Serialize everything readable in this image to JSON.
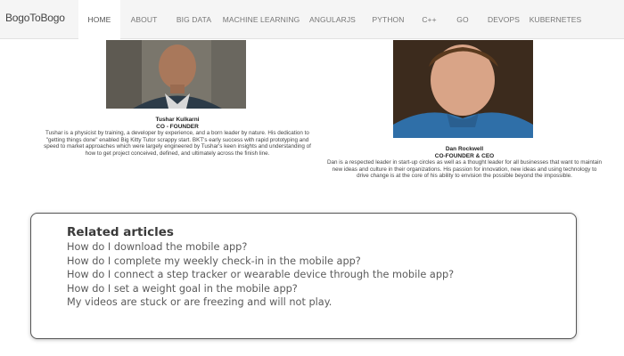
{
  "brand": "BogoToBogo",
  "nav": {
    "items": [
      {
        "label": "HOME",
        "active": true
      },
      {
        "label": "ABOUT"
      },
      {
        "label": "BIG DATA"
      },
      {
        "label": "MACHINE LEARNING"
      },
      {
        "label": "ANGULARJS"
      },
      {
        "label": "PYTHON"
      },
      {
        "label": "C++"
      },
      {
        "label": "GO"
      },
      {
        "label": "DEVOPS"
      },
      {
        "label": "KUBERNETES"
      }
    ]
  },
  "founders": [
    {
      "name": "Tushar Kulkarni",
      "role": "CO - FOUNDER",
      "bio": "Tushar is a physicist by training, a developer by experience, and a born leader by nature. His dedication to \"getting things done\" enabled Big Kitty Tutor scrappy start. BKT's early success with rapid prototyping and speed to market approaches which were largely engineered by Tushar's keen insights and understanding of how to get project conceived, defined, and ultimately across the finish line."
    },
    {
      "name": "Dan Rockwell",
      "role": "CO-FOUNDER & CEO",
      "bio": "Dan is a respected leader in start-up circles as well as a thought leader for all businesses that want to maintain new ideas and culture in their organizations. His passion for innovation, new ideas and using technology to drive change is at the core of his ability to envision the possible beyond the impossible."
    }
  ],
  "related": {
    "title": "Related articles",
    "articles": [
      "How do I download the mobile app?",
      "How do I complete my weekly check-in in the mobile app?",
      "How do I connect a step tracker or wearable device through the mobile app?",
      "How do I set a weight goal in the mobile app?",
      "My videos are stuck or are freezing and will not play."
    ]
  }
}
